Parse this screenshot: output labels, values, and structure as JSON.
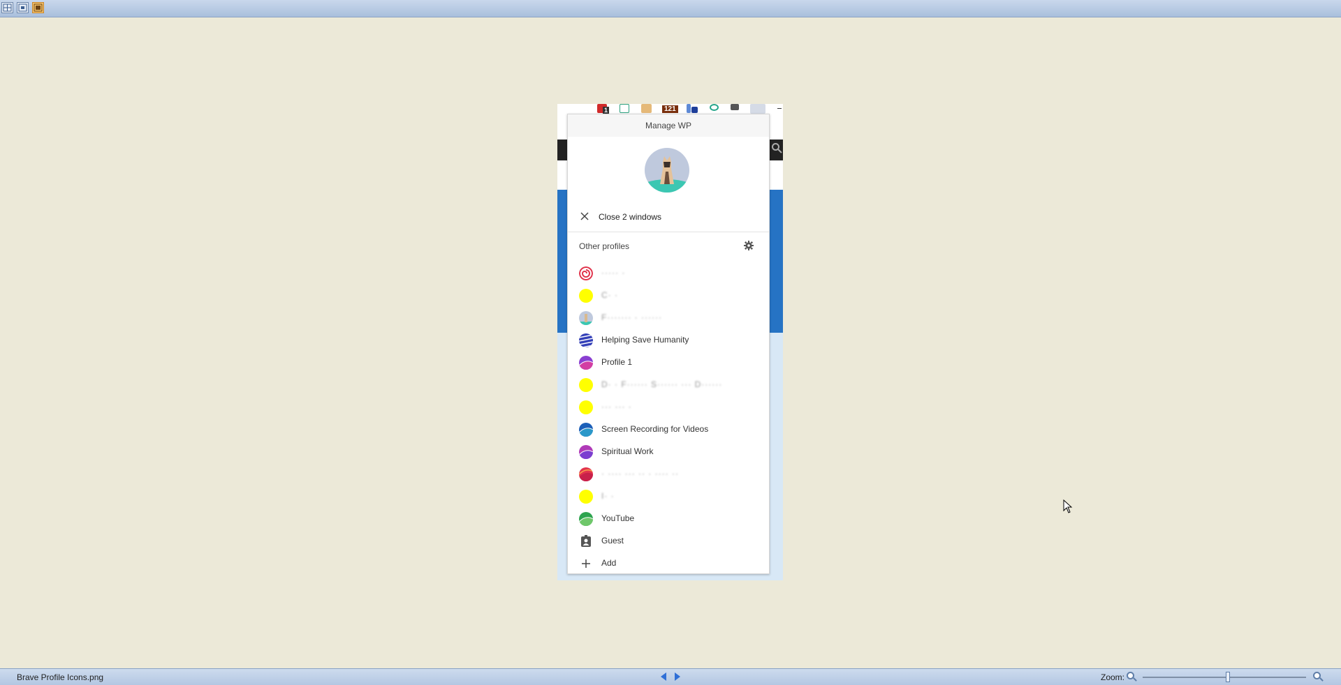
{
  "viewer": {
    "filename": "Brave Profile Icons.png",
    "zoom_label": "Zoom:",
    "zoom_level": 0.52
  },
  "menu": {
    "title": "Manage WP",
    "close_label": "Close 2 windows",
    "other_profiles_label": "Other profiles",
    "profiles": [
      {
        "label": "·····  ·",
        "icon": "swirl-red",
        "blurred": true
      },
      {
        "label": "C·  ·",
        "icon": "yellow",
        "blurred": true
      },
      {
        "label": "F·······  · ······",
        "icon": "cat",
        "blurred": true
      },
      {
        "label": "Helping Save Humanity",
        "icon": "blue-stripes",
        "blurred": false
      },
      {
        "label": "Profile 1",
        "icon": "purple-wave",
        "blurred": false
      },
      {
        "label": "D·  ·  F······ S······ ··· D······",
        "icon": "yellow",
        "blurred": true
      },
      {
        "label": "··· ··· ·",
        "icon": "yellow",
        "blurred": true
      },
      {
        "label": "Screen Recording for Videos",
        "icon": "teal-wave",
        "blurred": false
      },
      {
        "label": "Spiritual Work",
        "icon": "magenta-wave",
        "blurred": false
      },
      {
        "label": "· ···· ··· ·· · ····  ··",
        "icon": "red-wave",
        "blurred": true
      },
      {
        "label": "I·  ·",
        "icon": "yellow",
        "blurred": true
      },
      {
        "label": "YouTube",
        "icon": "green-wave",
        "blurred": false
      }
    ],
    "guest_label": "Guest",
    "add_label": "Add"
  },
  "extension_badges": {
    "first": "1",
    "second": "121"
  },
  "colors": {
    "desktop_bg": "#ece9d8",
    "accent_blue": "#2673c4",
    "profile_yellow": "#ffff00"
  }
}
